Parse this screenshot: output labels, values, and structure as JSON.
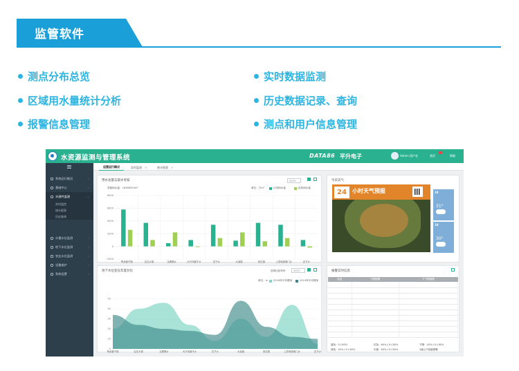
{
  "header": {
    "title": "监管软件"
  },
  "features": [
    "测点分布总览",
    "实时数据监测",
    "区域用水量统计分析",
    "历史数据记录、查询",
    "报警信息管理",
    "测点和用户信息管理"
  ],
  "app": {
    "title": "水资源监测与管理系统",
    "brand": "DATA86",
    "brand_cn": "平升电子",
    "user": "Admin 用户名",
    "home": "首页",
    "help": "帮助",
    "sidebar": [
      {
        "label": "系统运行概况"
      },
      {
        "label": "基础中心"
      },
      {
        "label": "水源井监测"
      },
      {
        "label": "计量水位监测"
      },
      {
        "label": "地下水位监测"
      },
      {
        "label": "农业水位监测"
      },
      {
        "label": "设备维护"
      },
      {
        "label": "系统设置"
      }
    ],
    "sidebar_sub": [
      "实时监控",
      "统计报表",
      "历史查询"
    ],
    "tabs": [
      "运营运行概况",
      "实时监测",
      "统计报表"
    ],
    "panel_usage": {
      "title": "用水总量与取水考核",
      "total": "总取用水量：18486503m³",
      "unit": "单位：万m³",
      "legend": [
        "计划用水量",
        "实际用水量"
      ],
      "select": "2019"
    },
    "panel_weather": {
      "title": "今日天气",
      "map_num": "24",
      "map_text": "小时天气预报",
      "cards": [
        {
          "day": "19",
          "temp": "31°"
        },
        {
          "day": "19",
          "temp": "30°"
        }
      ]
    },
    "panel_level": {
      "title": "地下水位变化年度对比",
      "select_label": "选择比较年份",
      "select": "2019",
      "unit": "单位：m",
      "legend": [
        "2018年平均埋深",
        "2019年平均埋深"
      ]
    },
    "panel_realtime": {
      "title": "报警实时信息",
      "columns": [
        "站名",
        "下限报警",
        "下下限报警"
      ],
      "foot": [
        "蓝色：0＜80%",
        "红色：60%＜0＜80%",
        "下降：40%＜0＜60%",
        "绿色：40%＜0＜60%",
        "中度：60%＜0＜80%",
        "5级以下轻度报警"
      ]
    }
  },
  "chart_data": [
    {
      "type": "bar",
      "categories": [
        "青龙营子镇",
        "吉庄乡镇",
        "玉峰寨乡",
        "大兴河营子乡",
        "花子乡",
        "大溪镇",
        "张庄镇",
        "上党地铁南门乡",
        "庄子乡"
      ],
      "series": [
        {
          "name": "计划用水量",
          "values": [
            5800,
            3700,
            500,
            1000,
            3400,
            900,
            3700,
            3400,
            1000
          ]
        },
        {
          "name": "实际用水量",
          "values": [
            2600,
            1000,
            2200,
            -100,
            1300,
            2200,
            800,
            1300,
            -200
          ]
        }
      ],
      "ylim": [
        -2000,
        8000
      ],
      "yticks": [
        -2000,
        0,
        2000,
        4000,
        6000,
        8000
      ]
    },
    {
      "type": "area",
      "categories": [
        "青龙营子镇",
        "吉庄乡镇",
        "玉峰寨乡",
        "大兴河营子乡",
        "花子乡",
        "大溪镇",
        "张庄镇",
        "上党地铁南门乡",
        "庄子乡"
      ],
      "series": [
        {
          "name": "2018年平均埋深",
          "values": [
            20,
            40,
            46,
            24,
            8,
            30,
            12,
            44,
            5
          ]
        },
        {
          "name": "2019年平均埋深",
          "values": [
            34,
            24,
            20,
            18,
            14,
            48,
            22,
            12,
            10
          ]
        }
      ],
      "ylim": [
        0,
        60
      ],
      "yticks": [
        0,
        10,
        20,
        30,
        40,
        50
      ]
    }
  ]
}
